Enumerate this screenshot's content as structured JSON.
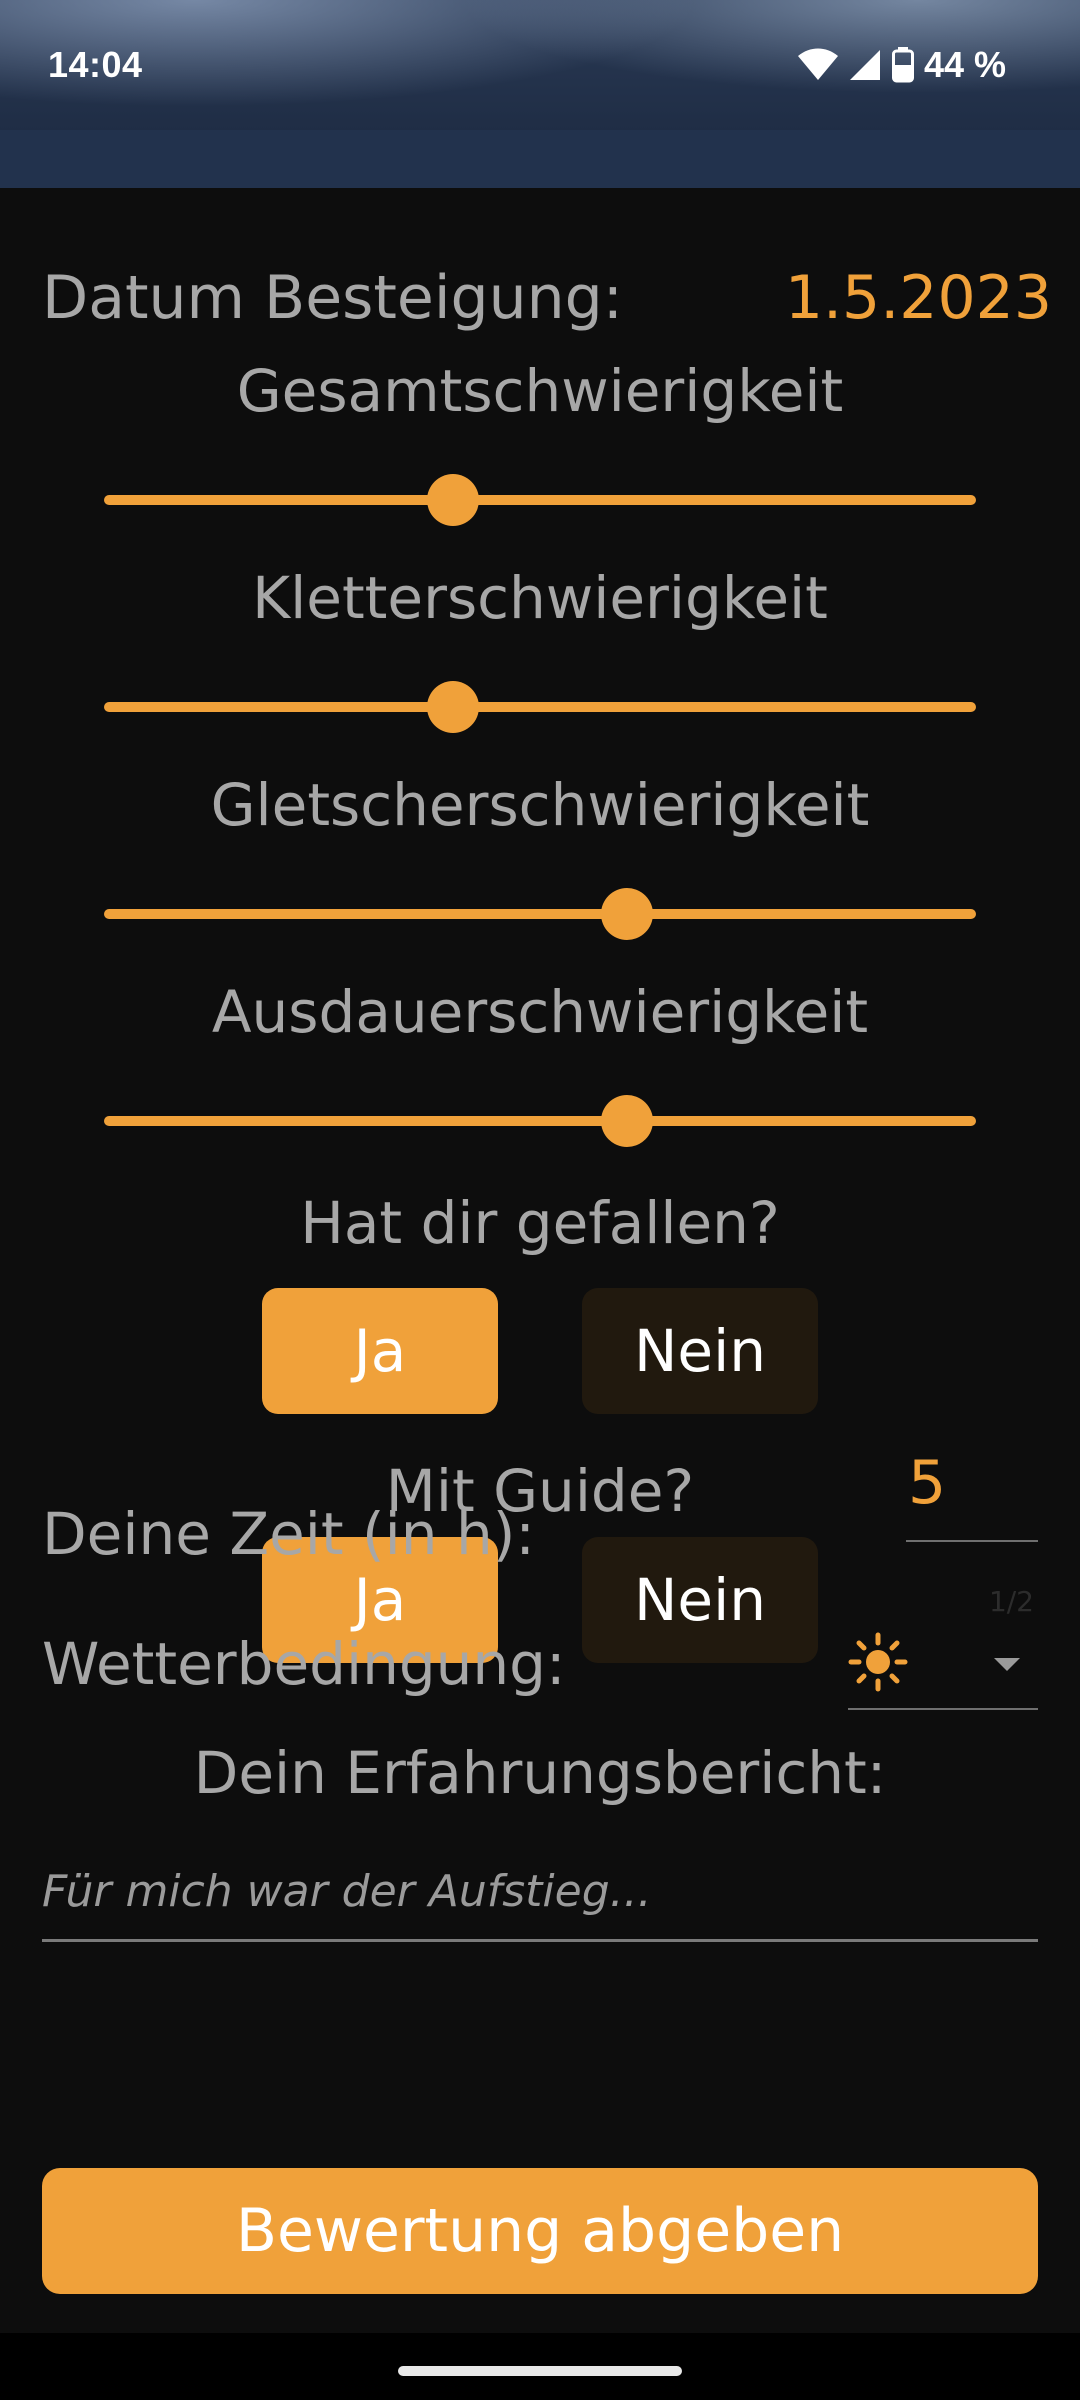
{
  "status_bar": {
    "time": "14:04",
    "battery": "44 %",
    "icons": [
      "wifi-icon",
      "signal-icon",
      "battery-icon"
    ]
  },
  "form": {
    "date_label": "Datum Besteigung:",
    "date_value": "1.5.2023",
    "sliders": [
      {
        "label": "Gesamtschwierigkeit",
        "value": 0.4
      },
      {
        "label": "Kletterschwierigkeit",
        "value": 0.4
      },
      {
        "label": "Gletscherschwierigkeit",
        "value": 0.6
      },
      {
        "label": "Ausdauerschwierigkeit",
        "value": 0.6
      }
    ],
    "liked": {
      "question": "Hat dir gefallen?",
      "yes": "Ja",
      "no": "Nein",
      "selected": "yes"
    },
    "guide": {
      "question": "Mit Guide?",
      "yes": "Ja",
      "no": "Nein",
      "selected": "yes"
    },
    "time": {
      "label": "Deine Zeit (in h):",
      "value": "5",
      "counter": "1/2"
    },
    "weather": {
      "label": "Wetterbedingung:",
      "selected_icon": "sun-icon"
    },
    "report": {
      "label": "Dein Erfahrungsbericht:",
      "placeholder": "Für mich war der Aufstieg..."
    },
    "submit_label": "Bewertung abgeben"
  },
  "colors": {
    "accent": "#f0a13a",
    "background": "#0d0d0d",
    "muted_text": "#a7a7a7",
    "inactive_button": "#21190e"
  }
}
